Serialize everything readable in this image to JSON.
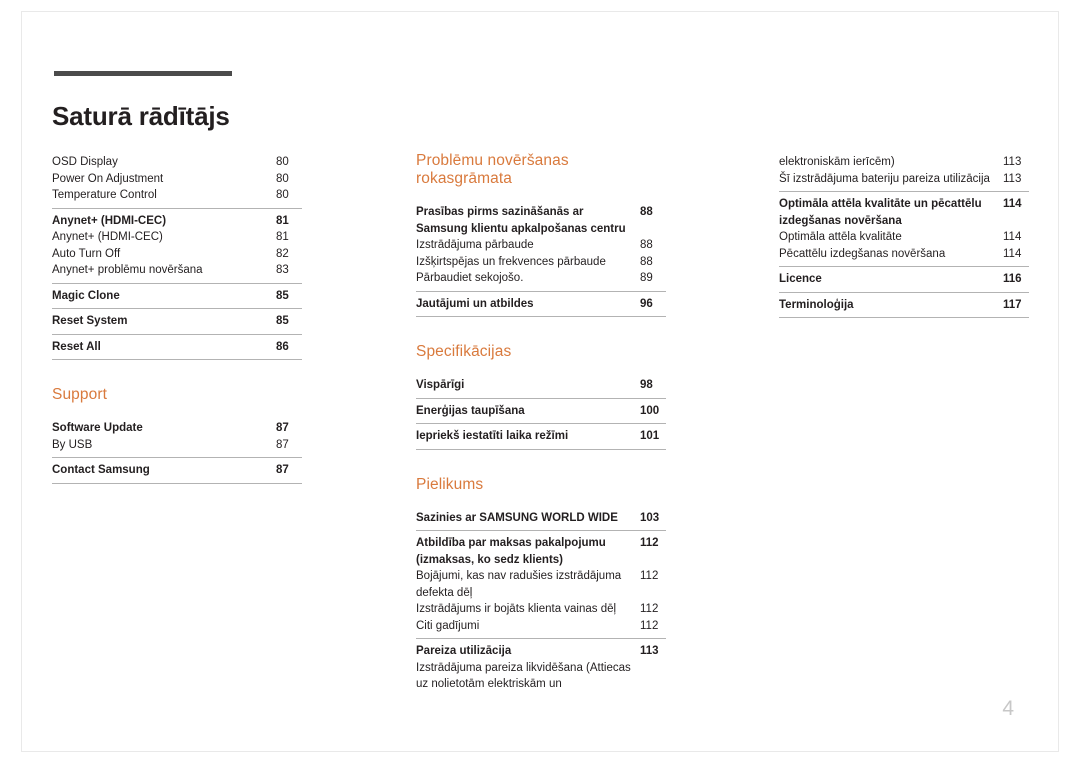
{
  "document": {
    "title": "Saturā rādītājs",
    "folio": "4",
    "accent_color": "#d97a3d",
    "text_color": "#231f20"
  },
  "columns": [
    {
      "id": "column-1",
      "blocks": [
        {
          "type": "entries",
          "items": [
            {
              "text": "OSD Display",
              "page": "80",
              "bold": false
            },
            {
              "text": "Power On Adjustment",
              "page": "80",
              "bold": false
            },
            {
              "text": "Temperature Control",
              "page": "80",
              "bold": false
            }
          ]
        },
        {
          "type": "rule"
        },
        {
          "type": "entries",
          "items": [
            {
              "text": "Anynet+ (HDMI-CEC)",
              "page": "81",
              "bold": true
            },
            {
              "text": "Anynet+ (HDMI-CEC)",
              "page": "81",
              "bold": false
            },
            {
              "text": "Auto Turn Off",
              "page": "82",
              "bold": false
            },
            {
              "text": "Anynet+ problēmu novēršana",
              "page": "83",
              "bold": false
            }
          ]
        },
        {
          "type": "rule"
        },
        {
          "type": "entries",
          "items": [
            {
              "text": "Magic Clone",
              "page": "85",
              "bold": true
            }
          ]
        },
        {
          "type": "rule"
        },
        {
          "type": "entries",
          "items": [
            {
              "text": "Reset System",
              "page": "85",
              "bold": true
            }
          ]
        },
        {
          "type": "rule"
        },
        {
          "type": "entries",
          "items": [
            {
              "text": "Reset All",
              "page": "86",
              "bold": true
            }
          ]
        },
        {
          "type": "rule"
        },
        {
          "type": "heading",
          "text": "Support"
        },
        {
          "type": "entries",
          "items": [
            {
              "text": "Software Update",
              "page": "87",
              "bold": true
            },
            {
              "text": "By USB",
              "page": "87",
              "bold": false
            }
          ]
        },
        {
          "type": "rule"
        },
        {
          "type": "entries",
          "items": [
            {
              "text": "Contact Samsung",
              "page": "87",
              "bold": true
            }
          ]
        },
        {
          "type": "rule"
        }
      ]
    },
    {
      "id": "column-2",
      "blocks": [
        {
          "type": "heading",
          "text": "Problēmu novēršanas rokasgrāmata"
        },
        {
          "type": "entries",
          "items": [
            {
              "text": "Prasības pirms sazināšanās ar Samsung klientu apkalpošanas centru",
              "page": "88",
              "bold": true
            },
            {
              "text": "Izstrādājuma pārbaude",
              "page": "88",
              "bold": false
            },
            {
              "text": "Izšķirtspējas un frekvences pārbaude",
              "page": "88",
              "bold": false
            },
            {
              "text": "Pārbaudiet sekojošo.",
              "page": "89",
              "bold": false
            }
          ]
        },
        {
          "type": "rule"
        },
        {
          "type": "entries",
          "items": [
            {
              "text": "Jautājumi un atbildes",
              "page": "96",
              "bold": true
            }
          ]
        },
        {
          "type": "rule"
        },
        {
          "type": "heading",
          "text": "Specifikācijas"
        },
        {
          "type": "entries",
          "items": [
            {
              "text": "Vispārīgi",
              "page": "98",
              "bold": true
            }
          ]
        },
        {
          "type": "rule"
        },
        {
          "type": "entries",
          "items": [
            {
              "text": "Enerģijas taupīšana",
              "page": "100",
              "bold": true
            }
          ]
        },
        {
          "type": "rule"
        },
        {
          "type": "entries",
          "items": [
            {
              "text": "Iepriekš iestatīti laika režīmi",
              "page": "101",
              "bold": true
            }
          ]
        },
        {
          "type": "rule"
        },
        {
          "type": "heading",
          "text": "Pielikums"
        },
        {
          "type": "entries",
          "items": [
            {
              "text": "Sazinies ar SAMSUNG WORLD WIDE",
              "page": "103",
              "bold": true
            }
          ]
        },
        {
          "type": "rule"
        },
        {
          "type": "entries",
          "items": [
            {
              "text": "Atbildība par maksas pakalpojumu (izmaksas, ko sedz klients)",
              "page": "112",
              "bold": true
            },
            {
              "text": "Bojājumi, kas nav radušies izstrādājuma defekta dēļ",
              "page": "112",
              "bold": false
            },
            {
              "text": "Izstrādājums ir bojāts klienta vainas dēļ",
              "page": "112",
              "bold": false
            },
            {
              "text": "Citi gadījumi",
              "page": "112",
              "bold": false
            }
          ]
        },
        {
          "type": "rule"
        },
        {
          "type": "entries",
          "items": [
            {
              "text": "Pareiza utilizācija",
              "page": "113",
              "bold": true
            },
            {
              "text": "Izstrādājuma pareiza likvidēšana (Attiecas uz nolietotām elektriskām un",
              "page": "",
              "bold": false
            }
          ]
        }
      ]
    },
    {
      "id": "column-3",
      "blocks": [
        {
          "type": "entries",
          "items": [
            {
              "text": "elektroniskām ierīcēm)",
              "page": "113",
              "bold": false
            },
            {
              "text": "Šī izstrādājuma bateriju pareiza utilizācija",
              "page": "113",
              "bold": false
            }
          ]
        },
        {
          "type": "rule"
        },
        {
          "type": "entries",
          "items": [
            {
              "text": "Optimāla attēla kvalitāte un pēcattēlu izdegšanas novēršana",
              "page": "114",
              "bold": true
            },
            {
              "text": "Optimāla attēla kvalitāte",
              "page": "114",
              "bold": false
            },
            {
              "text": "Pēcattēlu izdegšanas novēršana",
              "page": "114",
              "bold": false
            }
          ]
        },
        {
          "type": "rule"
        },
        {
          "type": "entries",
          "items": [
            {
              "text": "Licence",
              "page": "116",
              "bold": true
            }
          ]
        },
        {
          "type": "rule"
        },
        {
          "type": "entries",
          "items": [
            {
              "text": "Terminoloģija",
              "page": "117",
              "bold": true
            }
          ]
        },
        {
          "type": "rule"
        }
      ]
    }
  ]
}
